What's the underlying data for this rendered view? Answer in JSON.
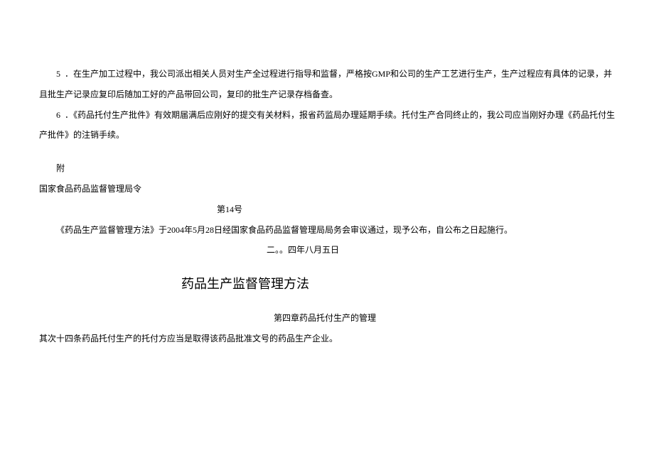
{
  "items": {
    "item5_num": "5",
    "item5_text": "．在生产加工过程中，我公司派出相关人员对生产全过程进行指导和监督，严格按GMP和公司的生产工艺进行生产，生产过程应有具体的记录，并且批生产记录应复印后随加工好的产品带回公司，复印的批生产记录存档备查。",
    "item6_num": "6",
    "item6_text": "．《药品托付生产批件》有效期届满后应刚好的提交有关材料，报省药监局办理延期手续。托付生产合同终止的，我公司应当刚好办理《药品托付生产批件》的注销手续。"
  },
  "appendix_label": "附",
  "order_title": "国家食品药品监督管理局令",
  "order_number": "第14号",
  "announcement": "《药品生产监督管理方法》于2004年5月28日经国家食品药品监督管理局局务会审议通过，现予公布，自公布之日起施行。",
  "date": "二。。四年八月五日",
  "main_title": "药品生产监督管理方法",
  "chapter": "第四章药品托付生产的管理",
  "article14": "其次十四条药品托付生产的托付方应当是取得该药品批准文号的药品生产企业。"
}
